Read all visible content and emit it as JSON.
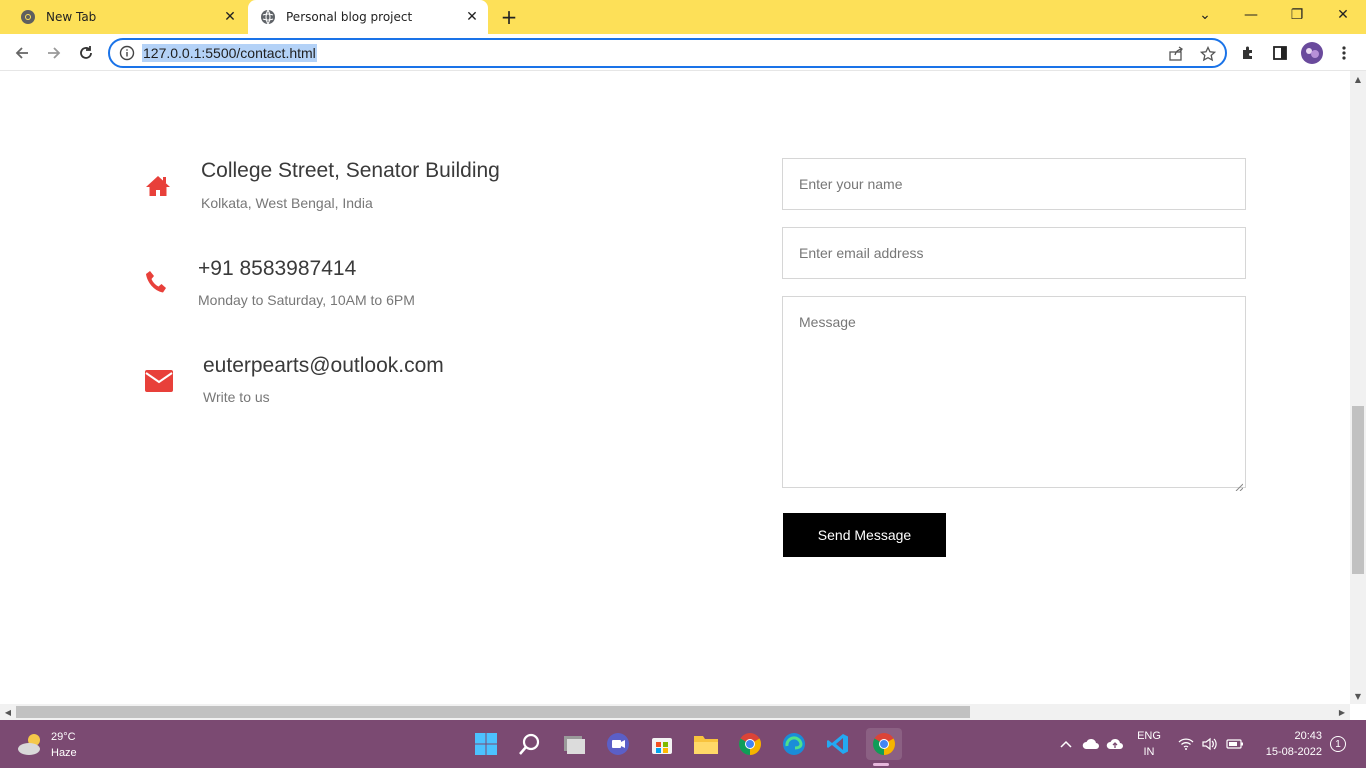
{
  "browser": {
    "tabs": [
      {
        "label": "New Tab",
        "active": false
      },
      {
        "label": "Personal blog project",
        "active": true
      }
    ],
    "url": "127.0.0.1:5500/contact.html",
    "window_controls": {
      "minimize": "—",
      "restore": "❐",
      "close": "✕"
    }
  },
  "contact": {
    "items": [
      {
        "icon": "home-icon",
        "title": "College Street, Senator Building",
        "subtitle": "Kolkata, West Bengal, India"
      },
      {
        "icon": "phone-icon",
        "title": "+91 8583987414",
        "subtitle": "Monday to Saturday, 10AM to 6PM"
      },
      {
        "icon": "envelope-icon",
        "title": "euterpearts@outlook.com",
        "subtitle": "Write to us"
      }
    ],
    "accent_color": "#e8403a"
  },
  "form": {
    "name_placeholder": "Enter your name",
    "email_placeholder": "Enter email address",
    "message_placeholder": "Message",
    "submit_label": "Send Message"
  },
  "taskbar": {
    "weather": {
      "temp": "29°C",
      "condition": "Haze"
    },
    "language": {
      "line1": "ENG",
      "line2": "IN"
    },
    "clock": {
      "time": "20:43",
      "date": "15-08-2022"
    },
    "notification_count": "1"
  }
}
